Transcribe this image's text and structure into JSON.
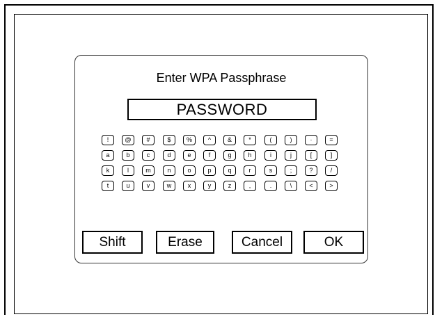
{
  "dialog": {
    "title": "Enter WPA Passphrase",
    "passphrase_value": "PASSWORD"
  },
  "keyboard": {
    "rows": [
      [
        "!",
        "@",
        "#",
        "$",
        "%",
        "^",
        "&",
        "*",
        "(",
        ")",
        "·",
        "="
      ],
      [
        "a",
        "b",
        "c",
        "d",
        "e",
        "f",
        "g",
        "h",
        "i",
        "j",
        "[",
        "]"
      ],
      [
        "k",
        "l",
        "m",
        "n",
        "o",
        "p",
        "q",
        "r",
        "s",
        ";",
        "?",
        "/"
      ],
      [
        "t",
        "u",
        "v",
        "w",
        "x",
        "y",
        "z",
        ",",
        ".",
        "\\",
        "<",
        ">"
      ]
    ]
  },
  "buttons": {
    "shift": "Shift",
    "erase": "Erase",
    "cancel": "Cancel",
    "ok": "OK"
  }
}
